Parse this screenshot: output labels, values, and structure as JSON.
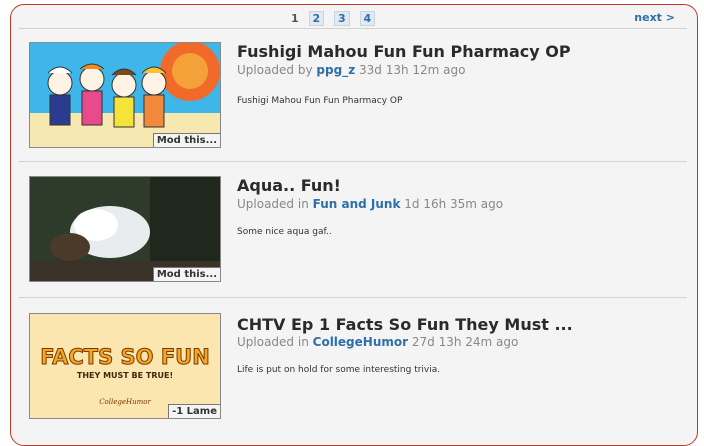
{
  "pager": {
    "current": "1",
    "pages": [
      "2",
      "3",
      "4"
    ],
    "next_label": "next >"
  },
  "videos": [
    {
      "title": "Fushigi Mahou Fun Fun Pharmacy OP",
      "meta_prefix": "Uploaded by",
      "meta_link": "ppg_z",
      "meta_time": "33d 13h 12m ago",
      "description": "Fushigi Mahou Fun Fun Pharmacy OP",
      "badge": "Mod this..."
    },
    {
      "title": "Aqua.. Fun!",
      "meta_prefix": "Uploaded in",
      "meta_link": "Fun and Junk",
      "meta_time": "1d 16h 35m ago",
      "description": "Some nice aqua gaf..",
      "badge": "Mod this..."
    },
    {
      "title": "CHTV Ep 1 Facts So Fun They Must ...",
      "meta_prefix": "Uploaded in",
      "meta_link": "CollegeHumor",
      "meta_time": "27d 13h 24m ago",
      "description": "Life is put on hold for some interesting trivia.",
      "badge": "-1 Lame",
      "thumb_text": {
        "headline": "FACTS SO FUN",
        "subline": "THEY MUST BE TRUE!",
        "logo": "CollegeHumor"
      }
    }
  ],
  "colors": {
    "accent": "#2f6fa8",
    "frame": "#c0392b",
    "background": "#f4f4f4"
  }
}
